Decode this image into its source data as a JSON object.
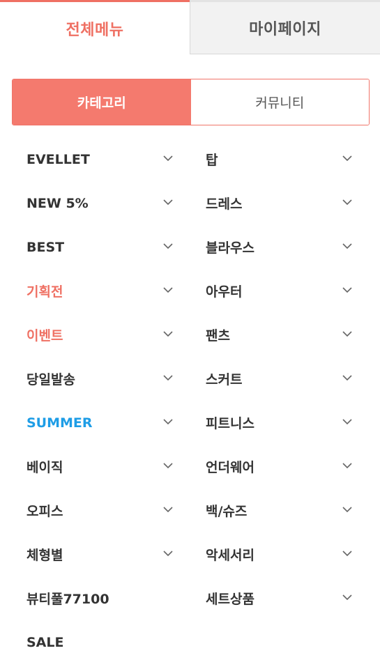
{
  "top_tabs": [
    {
      "label": "전체메뉴",
      "active": true
    },
    {
      "label": "마이페이지",
      "active": false
    }
  ],
  "segment": [
    {
      "label": "카테고리",
      "active": true
    },
    {
      "label": "커뮤니티",
      "active": false
    }
  ],
  "colors": {
    "accent": "#f47a6e",
    "highlight_red": "#ef7063",
    "highlight_blue": "#1e9de6",
    "text": "#333333"
  },
  "menu": {
    "left": [
      {
        "label": "EVELLET",
        "color": "#333333",
        "chevron": true
      },
      {
        "label": "NEW 5%",
        "color": "#333333",
        "chevron": true
      },
      {
        "label": "BEST",
        "color": "#333333",
        "chevron": true
      },
      {
        "label": "기획전",
        "color": "#ef7063",
        "chevron": true
      },
      {
        "label": "이벤트",
        "color": "#ef7063",
        "chevron": true
      },
      {
        "label": "당일발송",
        "color": "#333333",
        "chevron": true
      },
      {
        "label": "SUMMER",
        "color": "#1e9de6",
        "chevron": true
      },
      {
        "label": "베이직",
        "color": "#333333",
        "chevron": true
      },
      {
        "label": "오피스",
        "color": "#333333",
        "chevron": true
      },
      {
        "label": "체형별",
        "color": "#333333",
        "chevron": true
      },
      {
        "label": "뷰티풀77100",
        "color": "#333333",
        "chevron": false
      },
      {
        "label": "SALE",
        "color": "#333333",
        "chevron": false
      }
    ],
    "right": [
      {
        "label": "탑",
        "chevron": true
      },
      {
        "label": "드레스",
        "chevron": true
      },
      {
        "label": "블라우스",
        "chevron": true
      },
      {
        "label": "아우터",
        "chevron": true
      },
      {
        "label": "팬츠",
        "chevron": true
      },
      {
        "label": "스커트",
        "chevron": true
      },
      {
        "label": "피트니스",
        "chevron": true
      },
      {
        "label": "언더웨어",
        "chevron": true
      },
      {
        "label": "백/슈즈",
        "chevron": true
      },
      {
        "label": "악세서리",
        "chevron": true
      },
      {
        "label": "세트상품",
        "chevron": true
      }
    ]
  }
}
